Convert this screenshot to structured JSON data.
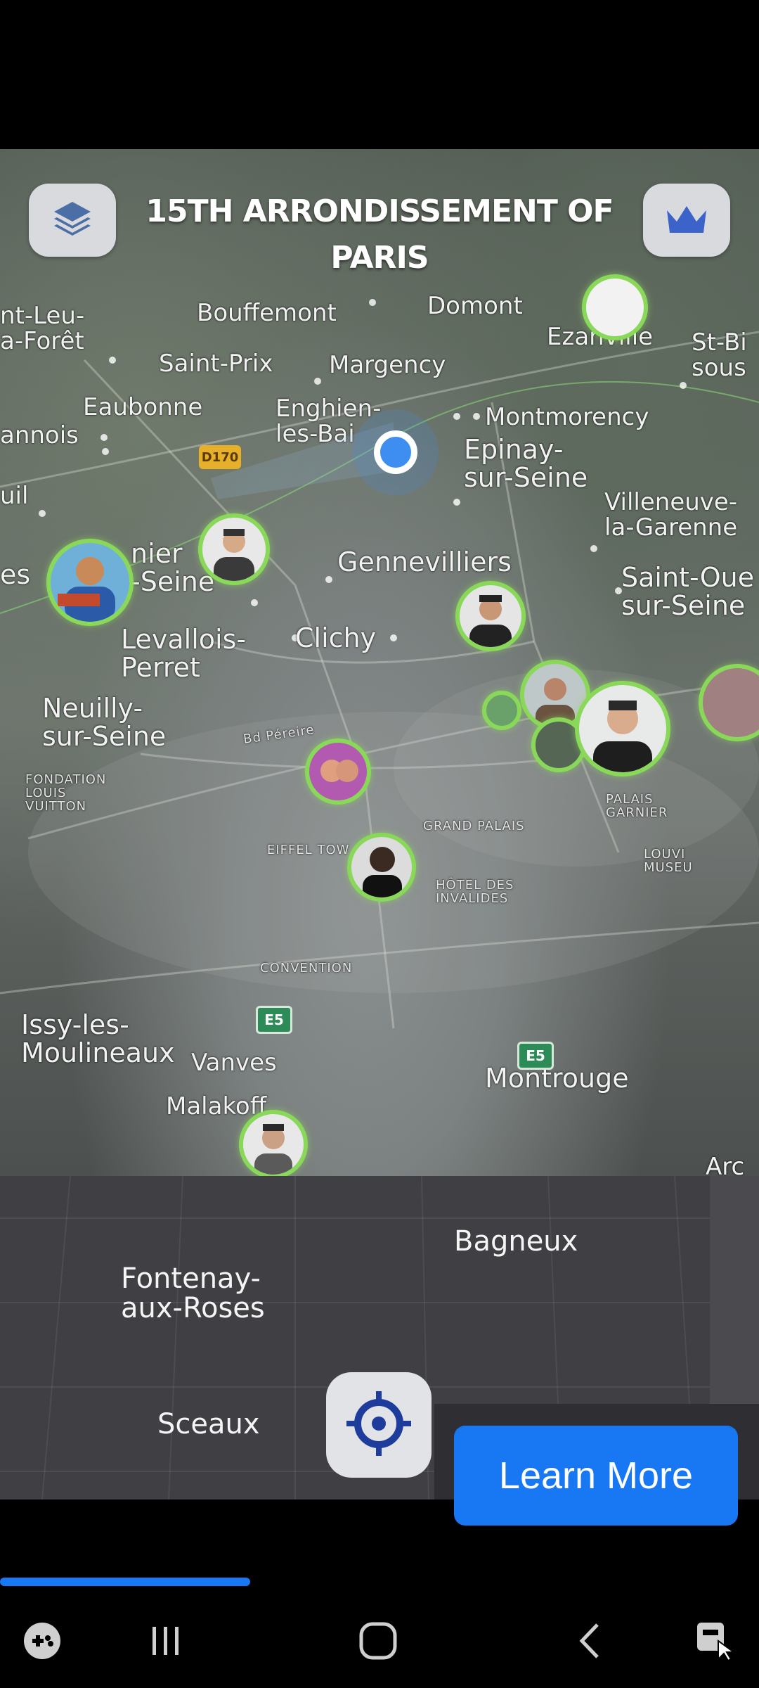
{
  "header": {
    "title": "15TH ARRONDISSEMENT OF PARIS"
  },
  "buttons": {
    "layers_icon": "layers-icon",
    "crown_icon": "crown-icon",
    "locate_icon": "crosshair-icon",
    "learn_more": "Learn More"
  },
  "map_labels": [
    {
      "text": "Bouffemont",
      "size": "l-med"
    },
    {
      "text": "Domont",
      "size": "l-med"
    },
    {
      "text": "Ezanville",
      "size": "l-med"
    },
    {
      "text": "St-Bi\nsous",
      "size": "l-med"
    },
    {
      "text": "nt-Leu-\na-Forêt",
      "size": "l-med"
    },
    {
      "text": "Saint-Prix",
      "size": "l-med"
    },
    {
      "text": "Margency",
      "size": "l-med"
    },
    {
      "text": "Eaubonne",
      "size": "l-med"
    },
    {
      "text": "Enghien-\nles-Bai",
      "size": "l-med"
    },
    {
      "text": "Montmorency",
      "size": "l-med"
    },
    {
      "text": "annois",
      "size": "l-med"
    },
    {
      "text": "Epinay-\nsur-Seine",
      "size": "l-big"
    },
    {
      "text": "uil",
      "size": "l-med"
    },
    {
      "text": "Villeneuve-\nla-Garenne",
      "size": "l-med"
    },
    {
      "text": "es",
      "size": "l-big"
    },
    {
      "text": "nier\n-Seine",
      "size": "l-big"
    },
    {
      "text": "Gennevilliers",
      "size": "l-big"
    },
    {
      "text": "Saint-Oue\nsur-Seine",
      "size": "l-big"
    },
    {
      "text": "Levallois-\nPerret",
      "size": "l-big"
    },
    {
      "text": "Clichy",
      "size": "l-big"
    },
    {
      "text": "Neuilly-\nsur-Seine",
      "size": "l-big"
    },
    {
      "text": "Bd Péreire",
      "size": "l-sm"
    },
    {
      "text": "FONDATION\nLOUIS\nVUITTON",
      "size": "l-sm"
    },
    {
      "text": "GRAND PALAIS",
      "size": "l-sm"
    },
    {
      "text": "PALAIS\nGARNIER",
      "size": "l-sm"
    },
    {
      "text": "EIFFEL TOW",
      "size": "l-sm"
    },
    {
      "text": "HÔTEL DES\nINVALIDES",
      "size": "l-sm"
    },
    {
      "text": "LOUVI\nMUSEU",
      "size": "l-sm"
    },
    {
      "text": "CONVENTION",
      "size": "l-sm"
    },
    {
      "text": "Issy-les-\nMoulineaux",
      "size": "l-big"
    },
    {
      "text": "Vanves",
      "size": "l-med"
    },
    {
      "text": "Malakoff",
      "size": "l-med"
    },
    {
      "text": "Montrouge",
      "size": "l-big"
    },
    {
      "text": "Arc",
      "size": "l-med"
    }
  ],
  "road_signs": {
    "d170": "D170",
    "e5a": "E5",
    "e5b": "E5"
  },
  "flat_labels": {
    "bagneux": "Bagneux",
    "fontenay": "Fontenay-\naux-Roses",
    "sceaux": "Sceaux"
  },
  "progress": {
    "fraction": 0.33
  },
  "navbar": {
    "game_icon": "gamepad-icon",
    "recents_icon": "recents-icon",
    "home_icon": "home-icon",
    "back_icon": "back-icon",
    "accessibility_icon": "accessibility-icon"
  },
  "colors": {
    "accent": "#1877f2",
    "avatar_ring": "#8ad85a",
    "user_dot": "#3d8ef0"
  }
}
